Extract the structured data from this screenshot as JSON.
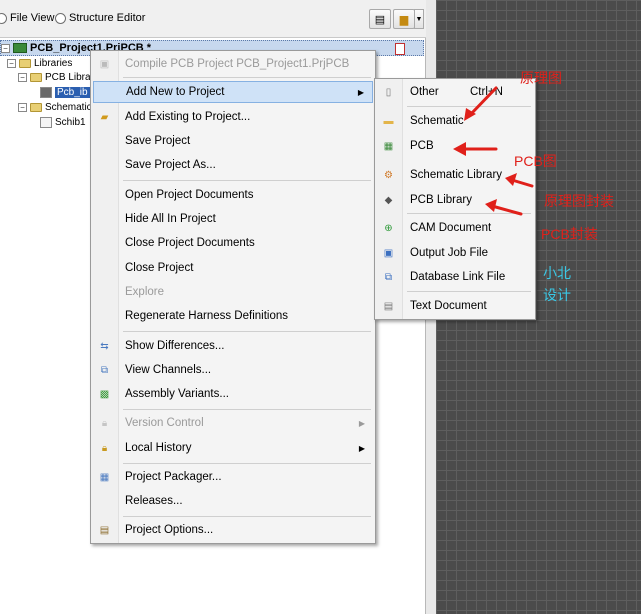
{
  "panel": {
    "view_options": {
      "file_view_label": "File View",
      "structure_editor_label": "Structure Editor"
    },
    "tree": {
      "project_name": "PCB_Project1.PrjPCB *",
      "libraries_label": "Libraries",
      "pcb_library_label": "PCB Libra",
      "pcb_lib_doc_label": "Pcb_ib",
      "schematic_label": "Schematic",
      "schlib_doc_label": "Schib1"
    }
  },
  "context_menu": {
    "items": [
      {
        "label": "Compile PCB Project PCB_Project1.PrjPCB",
        "disabled": true
      },
      {
        "label": "Add New to Project"
      },
      {
        "label": "Add Existing to Project..."
      },
      {
        "label": "Save Project"
      },
      {
        "label": "Save Project As..."
      },
      {
        "label": "Open Project Documents"
      },
      {
        "label": "Hide All In Project"
      },
      {
        "label": "Close Project Documents"
      },
      {
        "label": "Close Project"
      },
      {
        "label": "Explore",
        "disabled": true
      },
      {
        "label": "Regenerate Harness Definitions"
      },
      {
        "label": "Show Differences..."
      },
      {
        "label": "View Channels..."
      },
      {
        "label": "Assembly Variants..."
      },
      {
        "label": "Version Control",
        "disabled": true
      },
      {
        "label": "Local History"
      },
      {
        "label": "Project Packager..."
      },
      {
        "label": "Releases..."
      },
      {
        "label": "Project Options..."
      }
    ]
  },
  "submenu": {
    "items": [
      {
        "label": "Other",
        "shortcut": "Ctrl+N"
      },
      {
        "label": "Schematic"
      },
      {
        "label": "PCB"
      },
      {
        "label": "Schematic Library"
      },
      {
        "label": "PCB Library"
      },
      {
        "label": "CAM Document"
      },
      {
        "label": "Output Job File"
      },
      {
        "label": "Database Link File"
      },
      {
        "label": "Text Document"
      }
    ]
  },
  "annotations": {
    "schematic": "原理图",
    "pcb": "PCB图",
    "schlib": "原理图封装",
    "pcblib": "PCB封装",
    "watermark_line1": "小北",
    "watermark_line2": "设计"
  },
  "colors": {
    "annotation_red": "#e0201a",
    "watermark_cyan": "#39c8e6",
    "highlight": "#cfe2f7"
  }
}
